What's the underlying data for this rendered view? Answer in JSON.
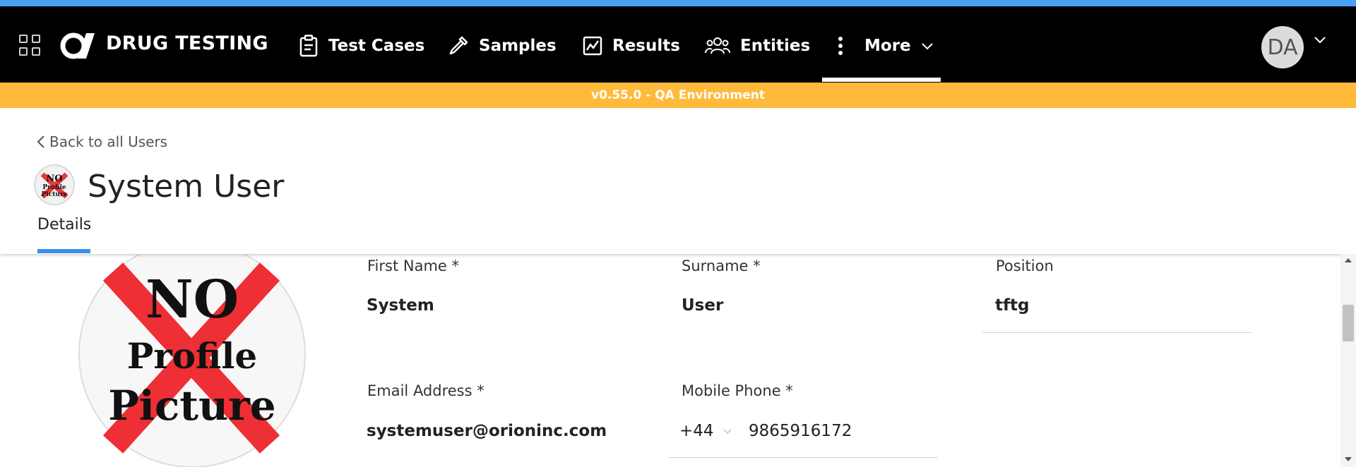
{
  "app": {
    "brand": "DRUG TESTING",
    "colors": {
      "accent": "#4a9ff5",
      "navbar": "#000000",
      "banner": "#ffba3b",
      "tab_indicator": "#3a8ee6"
    }
  },
  "nav": {
    "items": [
      {
        "label": "Test Cases",
        "icon": "clipboard-icon"
      },
      {
        "label": "Samples",
        "icon": "pipette-icon"
      },
      {
        "label": "Results",
        "icon": "chart-icon"
      },
      {
        "label": "Entities",
        "icon": "people-icon"
      },
      {
        "label": "More",
        "icon": "vertical-dots-icon"
      }
    ],
    "user_initials": "DA"
  },
  "banner": {
    "text": "v0.55.0 - QA Environment"
  },
  "header": {
    "back_label": "Back to all Users",
    "title": "System User",
    "avatar_text": [
      "NO",
      "Profile",
      "Picture"
    ],
    "tabs": [
      {
        "label": "Details"
      }
    ]
  },
  "form": {
    "profile_picture_text": [
      "NO",
      "Profile",
      "Picture"
    ],
    "first_name": {
      "label": "First Name *",
      "value": "System"
    },
    "surname": {
      "label": "Surname *",
      "value": "User"
    },
    "position": {
      "label": "Position",
      "value": "tftg"
    },
    "email": {
      "label": "Email Address *",
      "value": "systemuser@orioninc.com"
    },
    "mobile": {
      "label": "Mobile Phone *",
      "country_code": "+44",
      "number": "9865916172"
    }
  }
}
